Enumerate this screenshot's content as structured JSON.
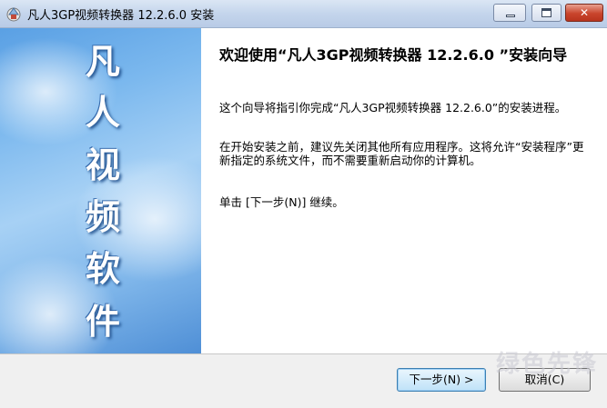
{
  "window": {
    "title": "凡人3GP视频转换器 12.2.6.0 安装",
    "icon": "installer-icon"
  },
  "banner": {
    "chars": [
      "凡",
      "人",
      "视",
      "频",
      "软",
      "件"
    ]
  },
  "content": {
    "heading": "欢迎使用“凡人3GP视频转换器 12.2.6.0 ”安装向导",
    "para1": "这个向导将指引你完成“凡人3GP视频转换器 12.2.6.0”的安装进程。",
    "para2": "在开始安装之前，建议先关闭其他所有应用程序。这将允许“安装程序”更新指定的系统文件，而不需要重新启动你的计算机。",
    "para3": "单击 [下一步(N)] 继续。"
  },
  "buttons": {
    "next": "下一步(N) >",
    "cancel": "取消(C)"
  },
  "watermark": "绿色先锋"
}
